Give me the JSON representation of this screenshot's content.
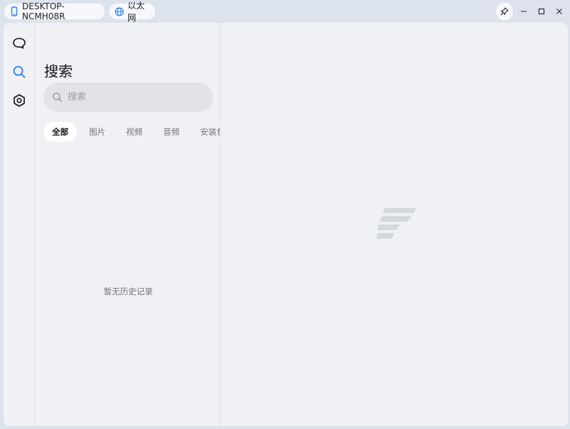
{
  "titlebar": {
    "device_name": "DESKTOP-NCMH08R",
    "network_name": "以太网"
  },
  "sidebar": {
    "items": [
      {
        "name": "chat",
        "icon": "chat-bubble-icon"
      },
      {
        "name": "search",
        "icon": "search-icon",
        "active": true
      },
      {
        "name": "settings",
        "icon": "settings-hexagon-icon"
      }
    ]
  },
  "search": {
    "title": "搜索",
    "placeholder": "搜索",
    "value": "",
    "tabs": [
      {
        "label": "全部",
        "active": true
      },
      {
        "label": "图片"
      },
      {
        "label": "视频"
      },
      {
        "label": "音频"
      },
      {
        "label": "安装包"
      }
    ],
    "empty_text": "暂无历史记录"
  },
  "colors": {
    "accent": "#2f7cf6",
    "background": "#eff1f5",
    "titlebar": "#dde3ec",
    "logo": "#d5d8dd"
  }
}
